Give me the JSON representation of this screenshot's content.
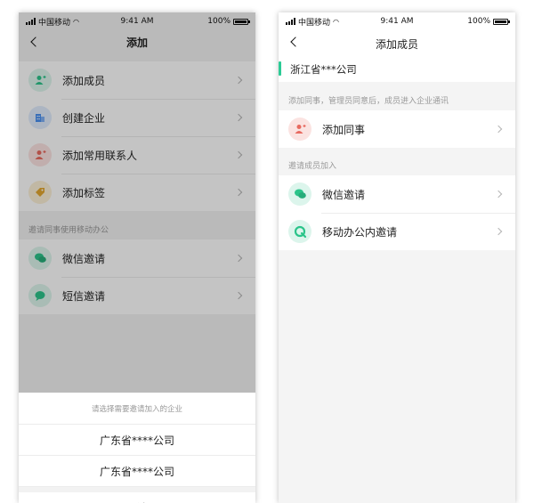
{
  "left_screen": {
    "status": {
      "carrier": "中国移动",
      "time": "9:41 AM",
      "battery": "100%"
    },
    "title": "添加",
    "items": [
      {
        "label": "添加成员",
        "icon": "add-member-icon",
        "color": "#2bc48a"
      },
      {
        "label": "创建企业",
        "icon": "building-icon",
        "color": "#4a8ff0"
      },
      {
        "label": "添加常用联系人",
        "icon": "add-contact-icon",
        "color": "#e86a60"
      },
      {
        "label": "添加标签",
        "icon": "tag-icon",
        "color": "#e3a72f"
      }
    ],
    "section_title": "邀请同事使用移动办公",
    "invite_items": [
      {
        "label": "微信邀请",
        "icon": "wechat-icon",
        "color": "#2bc48a"
      },
      {
        "label": "短信邀请",
        "icon": "sms-icon",
        "color": "#2bc48a"
      }
    ],
    "sheet": {
      "hint": "请选择需要邀请加入的企业",
      "options": [
        "广东省****公司",
        "广东省****公司"
      ],
      "cancel": "取消"
    }
  },
  "right_screen": {
    "status": {
      "carrier": "中国移动",
      "time": "9:41 AM",
      "battery": "100%"
    },
    "title": "添加成员",
    "company": "浙江省***公司",
    "section1": "添加同事，管理员同意后，成员进入企业通讯",
    "colleague_item": {
      "label": "添加同事",
      "icon": "add-colleague-icon",
      "color": "#e86a60"
    },
    "section2": "邀请成员加入",
    "invite_items": [
      {
        "label": "微信邀请",
        "icon": "wechat-icon",
        "color": "#2bc48a"
      },
      {
        "label": "移动办公内邀请",
        "icon": "mobile-office-icon",
        "color": "#2bc48a"
      }
    ]
  }
}
